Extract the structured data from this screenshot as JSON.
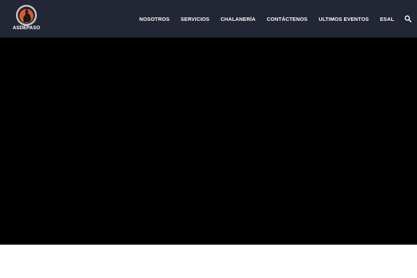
{
  "brand": {
    "logo_text": "ASDEPASO",
    "logo_icon": "horse-rider-emblem-icon"
  },
  "nav": {
    "items": [
      {
        "label": "NOSOTROS"
      },
      {
        "label": "SERVICIOS"
      },
      {
        "label": "CHALANERÍA"
      },
      {
        "label": "CONTÁCTENOS"
      },
      {
        "label": "ULTIMOS EVENTOS"
      },
      {
        "label": "ESAL"
      }
    ],
    "search_icon": "search-icon"
  },
  "colors": {
    "header_bg": "#232634",
    "nav_text": "#ffffff",
    "hero_bg": "#000000",
    "logo_ring": "#c9c9c9",
    "logo_fill": "#e4572e"
  }
}
